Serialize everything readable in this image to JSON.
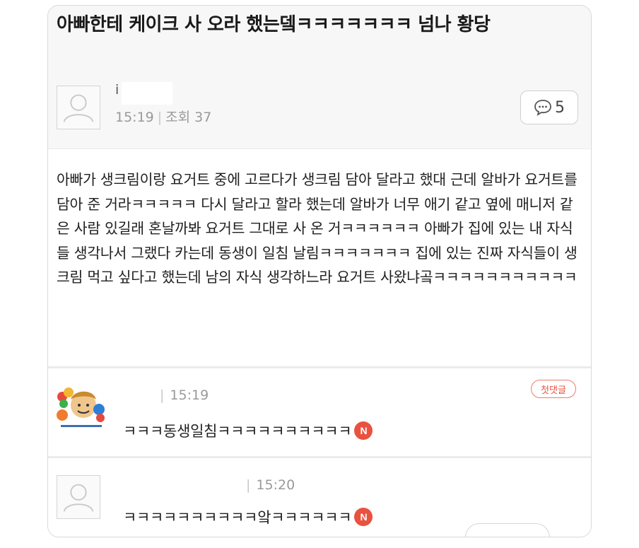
{
  "post": {
    "title": "아빠한테 케이크 사 오라 했는뎈ㅋㅋㅋㅋㅋㅋㅋ 넘나 황당",
    "author_initial": "i",
    "time": "15:19",
    "views_label": "조회 37",
    "comment_count": "5",
    "body": "아빠가 생크림이랑 요거트 중에 고르다가 생크림 담아 달라고 했대 근데 알바가 요거트를 담아 준 거라ㅋㅋㅋㅋㅋ 다시 달라고 할라 했는데 알바가 너무 애기 같고 옆에 매니저 같은 사람 있길래 혼날까봐 요거트 그대로 사 온 거ㅋㅋㅋㅋㅋㅋ 아빠가 집에 있는 내 자식들 생각나서 그랬다 카는데 동생이 일침 날림ㅋㅋㅋㅋㅋㅋㅋ 집에 있는 진짜 자식들이 생크림 먹고 싶다고 했는데 남의 자식 생각하느라 요거트 사왔냐곸ㅋㅋㅋㅋㅋㅋㅋㅋㅋㅋㅋ"
  },
  "comments": [
    {
      "time": "15:19",
      "badge": "첫댓글",
      "text": "ㅋㅋㅋ동생일침ㅋㅋㅋㅋㅋㅋㅋㅋㅋㅋ",
      "new_badge": "N"
    },
    {
      "time": "15:20",
      "text": "ㅋㅋㅋㅋㅋㅋㅋㅋㅋㅋ앜ㅋㅋㅋㅋㅋㅋ",
      "new_badge": "N"
    }
  ],
  "icons": {
    "comment": "speech-bubble-icon",
    "avatar": "default-avatar-icon"
  },
  "colors": {
    "accent": "#e8523f",
    "meta": "#9a9a9a",
    "border": "#d9d9d9"
  }
}
